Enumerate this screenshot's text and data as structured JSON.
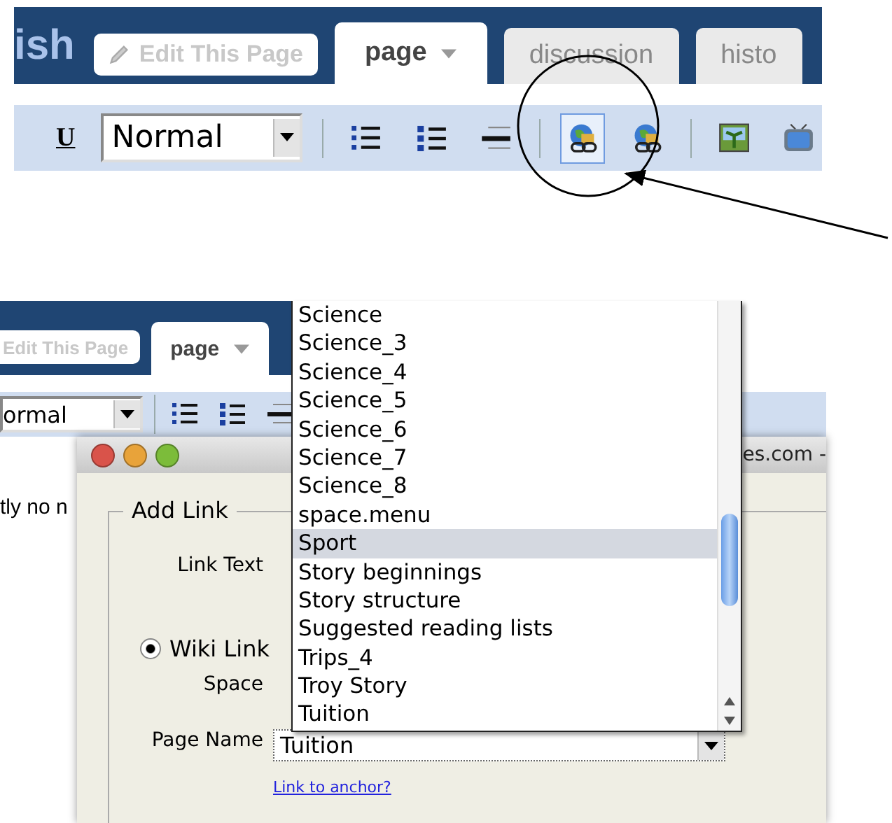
{
  "top_panel": {
    "site_title": "ish",
    "edit_button": {
      "label": "Edit This Page",
      "disabled": true
    },
    "tabs": [
      {
        "label": "page",
        "selected": true,
        "has_menu": true
      },
      {
        "label": "discussion",
        "selected": false,
        "has_menu": false
      },
      {
        "label": "histo",
        "selected": false,
        "has_menu": false
      }
    ],
    "toolbar": {
      "underline_label": "U",
      "format_select": "Normal",
      "buttons": [
        {
          "kind": "numbered-list"
        },
        {
          "kind": "bullet-list"
        },
        {
          "kind": "horizontal-rule"
        },
        {
          "kind": "separator"
        },
        {
          "kind": "link",
          "highlighted": true
        },
        {
          "kind": "external-link",
          "highlighted": false
        },
        {
          "kind": "separator"
        },
        {
          "kind": "image"
        },
        {
          "kind": "video"
        }
      ]
    }
  },
  "bottom_panel": {
    "edit_button": {
      "label": "Edit This Page",
      "disabled": true
    },
    "tabs": [
      {
        "label": "page",
        "selected": true,
        "has_menu": true
      }
    ],
    "toolbar": {
      "format_select": "ormal",
      "buttons": [
        {
          "kind": "numbered-list"
        },
        {
          "kind": "bullet-list"
        },
        {
          "kind": "horizontal-rule"
        }
      ]
    },
    "page_text": "tly no n",
    "dialog": {
      "title": "es.com -",
      "legend": "Add Link",
      "link_text_label": "Link Text",
      "wiki_link": {
        "label": "Wiki Link",
        "checked": true
      },
      "space_label": "Space",
      "page_name_label": "Page Name",
      "page_name_value": "Tuition",
      "anchor_link": "Link to anchor?",
      "dropdown": [
        {
          "label": "Science",
          "selected": false
        },
        {
          "label": "Science_3",
          "selected": false
        },
        {
          "label": "Science_4",
          "selected": false
        },
        {
          "label": "Science_5",
          "selected": false
        },
        {
          "label": "Science_6",
          "selected": false
        },
        {
          "label": "Science_7",
          "selected": false
        },
        {
          "label": "Science_8",
          "selected": false
        },
        {
          "label": "space.menu",
          "selected": false
        },
        {
          "label": "Sport",
          "selected": true
        },
        {
          "label": "Story beginnings",
          "selected": false
        },
        {
          "label": "Story structure",
          "selected": false
        },
        {
          "label": "Suggested reading lists",
          "selected": false
        },
        {
          "label": "Trips_4",
          "selected": false
        },
        {
          "label": "Troy Story",
          "selected": false
        },
        {
          "label": "Tuition",
          "selected": false
        }
      ]
    }
  }
}
